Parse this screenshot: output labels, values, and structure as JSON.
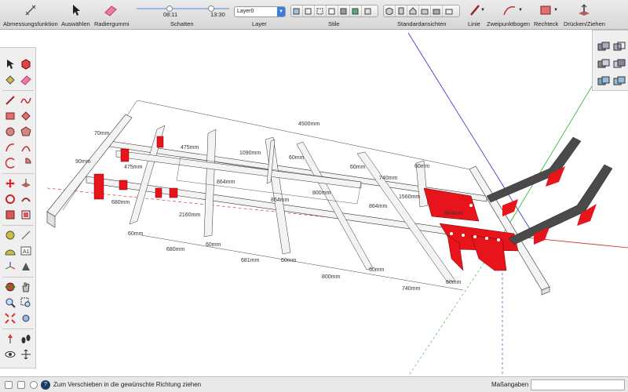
{
  "toolbar": {
    "dimension_label": "Abmessungsfunktion",
    "select_label": "Auswählen",
    "eraser_label": "Radiergummi",
    "shadows_label": "Schatten",
    "shadow_time_1": "08:11",
    "shadow_time_2": "13:30",
    "layer_label": "Layer",
    "layer_value": "Layer0",
    "styles_label": "Stile",
    "standard_views_label": "Standardansichten",
    "line_label": "Linie",
    "arc_label": "Zweipunktbogen",
    "rectangle_label": "Rechteck",
    "pushpull_label": "Drücken/Ziehen"
  },
  "status": {
    "message": "Zum Verschieben in die gewünschte Richtung ziehen",
    "measurements_label": "Maßangaben",
    "measurements_value": ""
  },
  "model": {
    "dimensions": {
      "d1090": "1090mm",
      "d864a": "864mm",
      "d864b": "864mm",
      "d864c": "864mm",
      "d864d": "864mm",
      "d800a": "800mm",
      "d800b": "800mm",
      "d740a": "740mm",
      "d740b": "740mm",
      "d680a": "680mm",
      "d680b": "680mm",
      "d681": "681mm",
      "d2160": "2160mm",
      "d1560": "1560mm",
      "d475a": "475mm",
      "d475b": "475mm",
      "d60a": "60mm",
      "d60b": "60mm",
      "d60c": "60mm",
      "d60d": "60mm",
      "d60e": "60mm",
      "d60f": "60mm",
      "d60g": "60mm",
      "d60h": "60mm",
      "d70": "70mm",
      "d90": "90mm",
      "d4500": "4500mm"
    }
  },
  "colors": {
    "frame_red": "#e8141b",
    "beam_light": "#f3f3f3",
    "beam_dark": "#4a4a4a",
    "axis_blue": "#2b2bd6",
    "axis_green": "#28b028",
    "axis_red": "#d02020"
  }
}
